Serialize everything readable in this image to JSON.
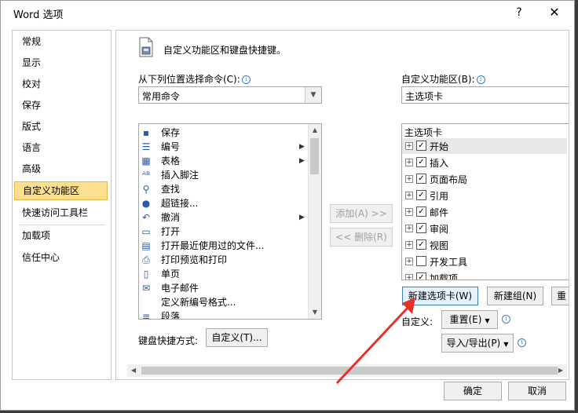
{
  "window": {
    "title": "Word 选项",
    "help": "?",
    "close": "✕"
  },
  "nav": {
    "items": [
      {
        "label": "常规",
        "active": false
      },
      {
        "label": "显示",
        "active": false
      },
      {
        "label": "校对",
        "active": false
      },
      {
        "label": "保存",
        "active": false
      },
      {
        "label": "版式",
        "active": false
      },
      {
        "label": "语言",
        "active": false
      },
      {
        "label": "高级",
        "active": false
      },
      {
        "label": "自定义功能区",
        "active": true
      },
      {
        "label": "快速访问工具栏",
        "active": false
      },
      {
        "label": "加载项",
        "active": false
      },
      {
        "label": "信任中心",
        "active": false
      }
    ]
  },
  "header": {
    "text": "自定义功能区和键盘快捷键。"
  },
  "left": {
    "choose_label": "从下列位置选择命令(C):",
    "choose_value": "常用命令",
    "commands": [
      {
        "icon": "save-icon",
        "glyph": "▪",
        "label": "保存",
        "submenu": false
      },
      {
        "icon": "numbering-icon",
        "glyph": "☰",
        "label": "编号",
        "submenu": true
      },
      {
        "icon": "table-icon",
        "glyph": "▦",
        "label": "表格",
        "submenu": true
      },
      {
        "icon": "footnote-icon",
        "glyph": "ᴬᴮ",
        "label": "插入脚注",
        "submenu": false
      },
      {
        "icon": "find-icon",
        "glyph": "⚲",
        "label": "查找",
        "submenu": false
      },
      {
        "icon": "hyperlink-icon",
        "glyph": "●",
        "label": "超链接...",
        "submenu": false
      },
      {
        "icon": "undo-icon",
        "glyph": "↶",
        "label": "撤消",
        "submenu": true
      },
      {
        "icon": "open-icon",
        "glyph": "▭",
        "label": "打开",
        "submenu": false
      },
      {
        "icon": "recent-file-icon",
        "glyph": "▤",
        "label": "打开最近使用过的文件...",
        "submenu": false
      },
      {
        "icon": "print-preview-icon",
        "glyph": "⎙",
        "label": "打印预览和打印",
        "submenu": false
      },
      {
        "icon": "single-page-icon",
        "glyph": "▯",
        "label": "单页",
        "submenu": false
      },
      {
        "icon": "email-icon",
        "glyph": "✉",
        "label": "电子邮件",
        "submenu": false
      },
      {
        "icon": "new-numbering-icon",
        "glyph": "",
        "label": "定义新编号格式...",
        "submenu": false
      },
      {
        "icon": "paragraph-icon",
        "glyph": "≡",
        "label": "段落",
        "submenu": false
      }
    ],
    "shortcut_label": "键盘快捷方式:",
    "customize_button": "自定义(T)..."
  },
  "middle": {
    "add_button": "添加(A) >>",
    "remove_button": "<< 删除(R)"
  },
  "right": {
    "ribbon_label": "自定义功能区(B):",
    "ribbon_value": "主选项卡",
    "tree_header": "主选项卡",
    "tabs": [
      {
        "label": "开始",
        "checked": true,
        "highlight": true
      },
      {
        "label": "插入",
        "checked": true,
        "highlight": false
      },
      {
        "label": "页面布局",
        "checked": true,
        "highlight": false
      },
      {
        "label": "引用",
        "checked": true,
        "highlight": false
      },
      {
        "label": "邮件",
        "checked": true,
        "highlight": false
      },
      {
        "label": "审阅",
        "checked": true,
        "highlight": false
      },
      {
        "label": "视图",
        "checked": true,
        "highlight": false
      },
      {
        "label": "开发工具",
        "checked": false,
        "highlight": false
      },
      {
        "label": "加载项",
        "checked": true,
        "highlight": false
      }
    ],
    "new_tab_button": "新建选项卡(W)",
    "new_group_button": "新建组(N)",
    "rename_button_partial": "重",
    "custom_label": "自定义:",
    "reset_button": "重置(E)",
    "import_export_button": "导入/导出(P)"
  },
  "footer": {
    "ok_button": "确定",
    "cancel_button": "取消"
  },
  "colors": {
    "nav_active_bg": "#fcdf8f",
    "annotation_arrow": "#e8302a"
  }
}
